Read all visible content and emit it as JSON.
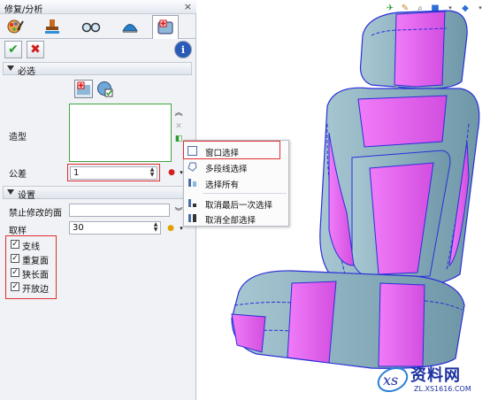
{
  "panel": {
    "title": "修复/分析",
    "close_glyph": "×",
    "tabs": [
      "brush-icon",
      "stamp-icon",
      "glasses-icon",
      "shell-icon",
      "medkit-icon"
    ],
    "ok_glyph": "✔",
    "cancel_glyph": "✖",
    "info_glyph": "i"
  },
  "required": {
    "header": "必选",
    "shape_label": "造型",
    "tolerance_label": "公差",
    "tolerance_value": "1"
  },
  "settings": {
    "header": "设置",
    "forbid_label": "禁止修改的面",
    "forbid_value": "",
    "sample_label": "取样",
    "sample_value": "30",
    "checkboxes": [
      {
        "label": "支线",
        "checked": true
      },
      {
        "label": "重复面",
        "checked": true
      },
      {
        "label": "狭长面",
        "checked": true
      },
      {
        "label": "开放边",
        "checked": true
      }
    ]
  },
  "context_menu": {
    "items": [
      "窗口选择",
      "多段线选择",
      "选择所有",
      "取消最后一次选择",
      "取消全部选择"
    ]
  },
  "watermark": {
    "brand": "资料网",
    "url": "ZL.XS1616.COM"
  },
  "colors": {
    "seat_magenta": "#e45cf0",
    "seat_teal": "#86aebd",
    "seam_blue": "#2a2fd8",
    "highlight_red": "#e03030",
    "selection_green": "#3ea83e"
  }
}
